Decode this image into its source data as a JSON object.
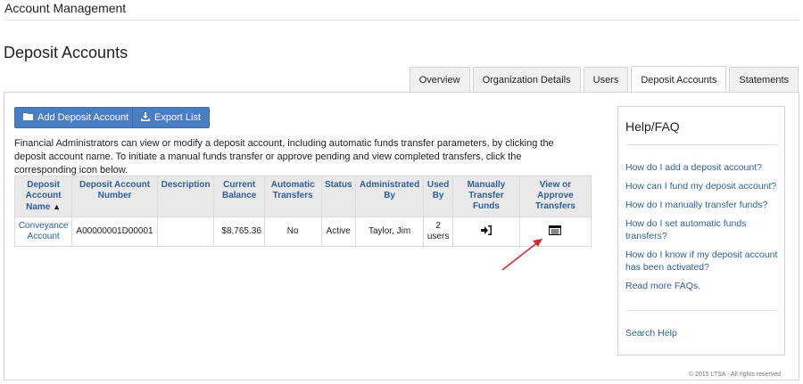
{
  "header": {
    "title": "Account Management"
  },
  "page": {
    "title": "Deposit Accounts"
  },
  "tabs": [
    {
      "label": "Overview",
      "active": false
    },
    {
      "label": "Organization Details",
      "active": false
    },
    {
      "label": "Users",
      "active": false
    },
    {
      "label": "Deposit Accounts",
      "active": true
    },
    {
      "label": "Statements",
      "active": false
    }
  ],
  "toolbar": {
    "add_label": "Add Deposit Account",
    "add_icon": "folder-icon",
    "export_label": "Export List",
    "export_icon": "download-icon"
  },
  "description": "Financial Administrators can view or modify a deposit account, including automatic funds transfer parameters, by clicking the deposit account name. To initiate a manual funds transfer or approve pending and view completed transfers, click the corresponding icon below.",
  "table": {
    "headers": {
      "name": "Deposit Account Name",
      "number": "Deposit Account Number",
      "description": "Description",
      "balance": "Current Balance",
      "auto": "Automatic Transfers",
      "status": "Status",
      "admin": "Administrated By",
      "used": "Used By",
      "manual": "Manually Transfer Funds",
      "view": "View or Approve Transfers"
    },
    "sort_indicator": "caret-up-icon",
    "rows": [
      {
        "name": "Conveyance Account",
        "number": "A00000001D00001",
        "description": "",
        "balance": "$8,765.36",
        "auto": "No",
        "status": "Active",
        "admin": "Taylor, Jim",
        "used": "2 users",
        "manual_icon": "sign-in-icon",
        "view_icon": "list-window-icon"
      }
    ]
  },
  "help": {
    "title": "Help/FAQ",
    "links": [
      "How do I add a deposit account?",
      "How can I fund my deposit account?",
      "How do I manually transfer funds?",
      "How do I set automatic funds transfers?",
      "How do I know if my deposit account has been activated?",
      "Read more FAQs."
    ],
    "search": "Search Help"
  },
  "footer": "© 2015 LTSA - All rights reserved.",
  "colors": {
    "link": "#2e5e9e",
    "button": "#4a7ec2",
    "annotation_arrow": "#c9302c"
  }
}
